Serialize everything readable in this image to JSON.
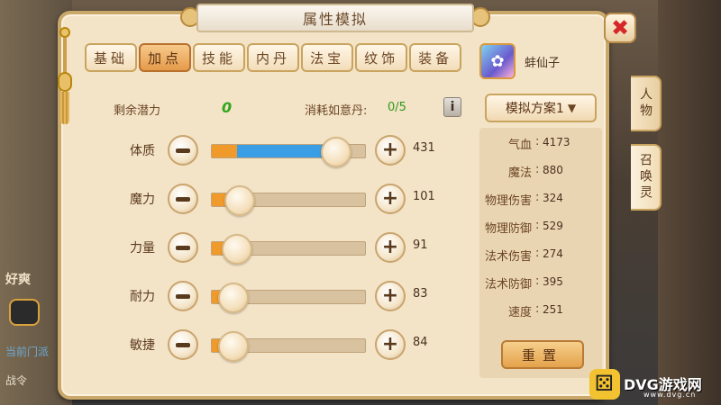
{
  "window": {
    "title": "属性模拟"
  },
  "tabs": [
    {
      "label": "基础",
      "active": false
    },
    {
      "label": "加点",
      "active": true
    },
    {
      "label": "技能",
      "active": false
    },
    {
      "label": "内丹",
      "active": false
    },
    {
      "label": "法宝",
      "active": false
    },
    {
      "label": "纹饰",
      "active": false
    },
    {
      "label": "装备",
      "active": false
    }
  ],
  "potential": {
    "label": "剩余潜力",
    "value": "0"
  },
  "consume": {
    "label": "消耗如意丹:",
    "value": "0/5"
  },
  "stats": [
    {
      "label": "体质",
      "value": "431",
      "bar_fraction": 0.8,
      "committed_fraction": 0.16
    },
    {
      "label": "魔力",
      "value": "101",
      "bar_fraction": 0.18,
      "committed_fraction": 0.18
    },
    {
      "label": "力量",
      "value": "91",
      "bar_fraction": 0.16,
      "committed_fraction": 0.16
    },
    {
      "label": "耐力",
      "value": "83",
      "bar_fraction": 0.14,
      "committed_fraction": 0.14
    },
    {
      "label": "敏捷",
      "value": "84",
      "bar_fraction": 0.14,
      "committed_fraction": 0.14
    }
  ],
  "pet": {
    "name": "蚌仙子"
  },
  "plan": {
    "label": "模拟方案1"
  },
  "attributes": [
    {
      "name": "气血",
      "value": "4173"
    },
    {
      "name": "魔法",
      "value": "880"
    },
    {
      "name": "物理伤害",
      "value": "324"
    },
    {
      "name": "物理防御",
      "value": "529"
    },
    {
      "name": "法术伤害",
      "value": "274"
    },
    {
      "name": "法术防御",
      "value": "395"
    },
    {
      "name": "速度",
      "value": "251"
    }
  ],
  "reset": {
    "label": "重置"
  },
  "side_tabs": [
    {
      "label": "人物"
    },
    {
      "label": "召唤灵"
    }
  ],
  "background": {
    "text_a": "好爽",
    "text_b": "当前门派",
    "text_c": "战令"
  },
  "watermark": {
    "text": "DVG游戏网",
    "sub": "www.dvg.cn"
  },
  "colors": {
    "accent": "#e59b4b",
    "blue_fill": "#3a9ee6",
    "orange_fill": "#f09a2c",
    "close": "#d62828",
    "green": "#2fa51c"
  },
  "icons": {
    "close": "close-icon",
    "info": "info-icon",
    "minus": "minus-icon",
    "plus": "plus-icon",
    "chevron": "chevron-down-icon"
  }
}
